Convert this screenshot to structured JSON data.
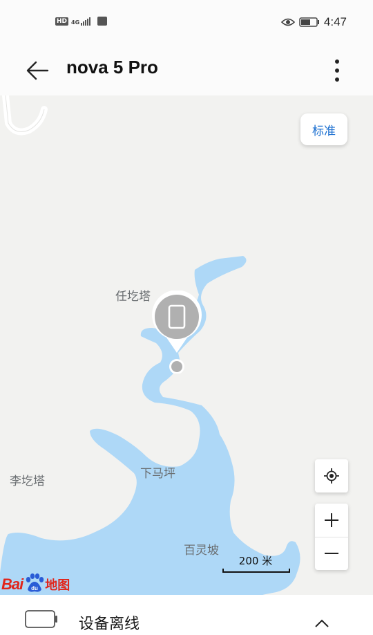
{
  "status_bar": {
    "hd": "HD",
    "network": "4G",
    "time": "4:47"
  },
  "header": {
    "title": "nova 5 Pro"
  },
  "map": {
    "style_button": "标准",
    "places": {
      "rengeta": "任圪塔",
      "xiamaping": "下马坪",
      "ligeta": "李圪塔",
      "bailingpo": "百灵坡"
    },
    "scale_label": "200 米",
    "logo_text": "Baidu地图"
  },
  "bottom_panel": {
    "device_status": "设备离线"
  },
  "colors": {
    "accent": "#1b6fd0",
    "water": "#aed8f7",
    "land": "#f2f2f0",
    "marker": "#b0b0b0"
  }
}
